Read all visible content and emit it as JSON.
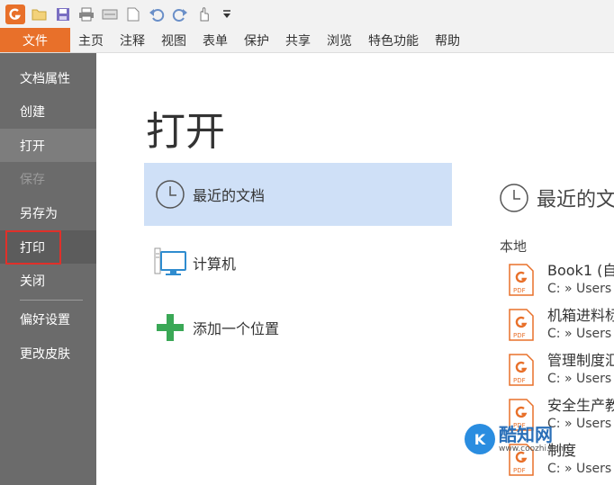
{
  "menubar": {
    "file_tab": "文件",
    "items": [
      "主页",
      "注释",
      "视图",
      "表单",
      "保护",
      "共享",
      "浏览",
      "特色功能",
      "帮助"
    ]
  },
  "sidebar": {
    "items": [
      "文档属性",
      "创建",
      "打开",
      "保存",
      "另存为",
      "打印",
      "关闭",
      "偏好设置",
      "更改皮肤"
    ],
    "active": "打开",
    "disabled": "保存",
    "highlighted": "打印"
  },
  "main": {
    "title": "打开",
    "locations": [
      "最近的文档",
      "计算机",
      "添加一个位置"
    ],
    "selected_location": "最近的文档"
  },
  "recent": {
    "header": "最近的文",
    "section_local": "本地",
    "files": [
      {
        "name": "Book1 (自",
        "path": "C: » Users »"
      },
      {
        "name": "机箱进料标",
        "path": "C: » Users »"
      },
      {
        "name": "管理制度汇",
        "path": "C: » Users »"
      },
      {
        "name": "安全生产教",
        "path": "C: » Users »"
      },
      {
        "name": "制度",
        "path": "C: » Users »"
      }
    ]
  },
  "watermark": {
    "title": "酷知网",
    "url": "www.coozhi.com",
    "logo_letter": "K"
  },
  "colors": {
    "accent": "#e8702a",
    "sidebar_bg": "#6b6b6b",
    "selected_bg": "#cfe0f7",
    "highlight_border": "#e0302a"
  },
  "icons": {
    "qat": [
      "app-logo-icon",
      "open-folder-icon",
      "save-icon",
      "print-icon",
      "scan-icon",
      "new-doc-icon",
      "undo-icon",
      "redo-icon",
      "hand-tool-icon",
      "customize-icon"
    ],
    "locations": [
      "clock-icon",
      "computer-icon",
      "plus-icon"
    ],
    "file": "pdf-file-icon"
  }
}
